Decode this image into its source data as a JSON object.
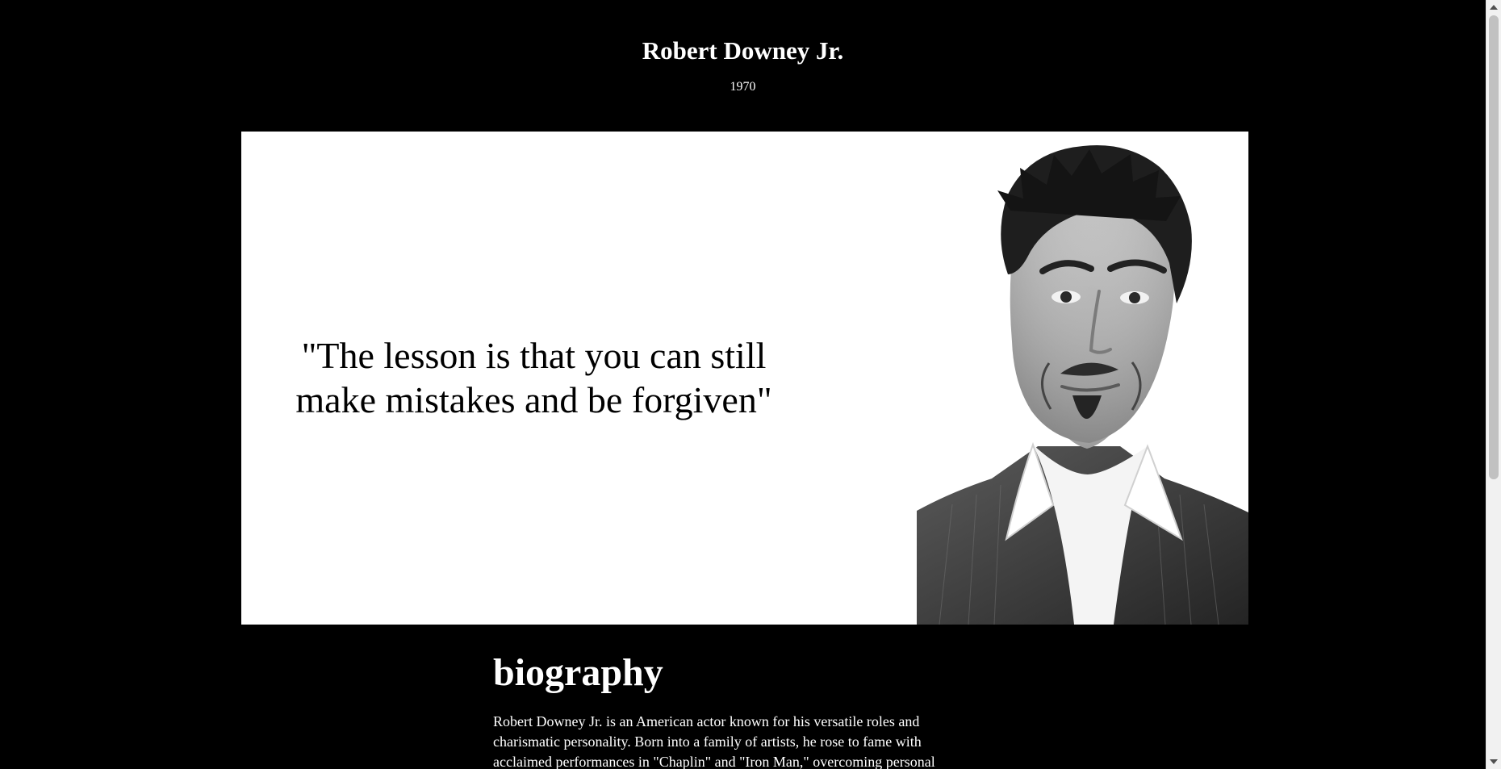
{
  "header": {
    "title": "Robert Downey Jr.",
    "birth_year": "1970"
  },
  "hero": {
    "quote": "\"The lesson is that you can still make mistakes and be forgiven\"",
    "portrait_icon": "portrait-photo"
  },
  "biography": {
    "heading": "biography",
    "text": "Robert Downey Jr. is an American actor known for his versatile roles and charismatic personality. Born into a family of artists, he rose to fame with acclaimed performances in \"Chaplin\" and \"Iron Man,\" overcoming personal"
  },
  "colors": {
    "background": "#000000",
    "hero_background": "#ffffff",
    "text_light": "#ffffff",
    "text_dark": "#000000"
  }
}
